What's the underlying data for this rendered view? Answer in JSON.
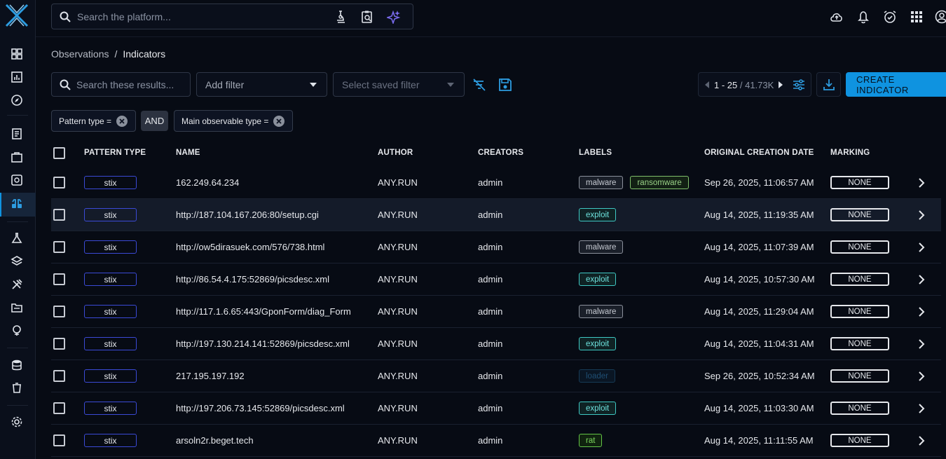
{
  "search": {
    "placeholder": "Search the platform..."
  },
  "breadcrumb": {
    "parent": "Observations",
    "separator": "/",
    "current": "Indicators"
  },
  "toolbar": {
    "search_placeholder": "Search these results...",
    "add_filter": "Add filter",
    "saved_filter": "Select saved filter",
    "pager_range": "1 - 25",
    "pager_total": " / 41.73K",
    "create_button": "CREATE INDICATOR"
  },
  "filters": {
    "chip1": "Pattern type =",
    "operator": "AND",
    "chip2": "Main observable type ="
  },
  "table": {
    "headers": {
      "pattern_type": "PATTERN TYPE",
      "name": "NAME",
      "author": "AUTHOR",
      "creators": "CREATORS",
      "labels": "LABELS",
      "date": "ORIGINAL CREATION DATE",
      "marking": "MARKING"
    },
    "rows": [
      {
        "pattern": "stix",
        "name": "162.249.64.234",
        "author": "ANY.RUN",
        "creator": "admin",
        "labels": [
          "malware",
          "ransomware"
        ],
        "date": "Sep 26, 2025, 11:06:57 AM",
        "marking": "NONE"
      },
      {
        "pattern": "stix",
        "name": "http://187.104.167.206:80/setup.cgi",
        "author": "ANY.RUN",
        "creator": "admin",
        "labels": [
          "exploit"
        ],
        "date": "Aug 14, 2025, 11:19:35 AM",
        "marking": "NONE"
      },
      {
        "pattern": "stix",
        "name": "http://ow5dirasuek.com/576/738.html",
        "author": "ANY.RUN",
        "creator": "admin",
        "labels": [
          "malware"
        ],
        "date": "Aug 14, 2025, 11:07:39 AM",
        "marking": "NONE"
      },
      {
        "pattern": "stix",
        "name": "http://86.54.4.175:52869/picsdesc.xml",
        "author": "ANY.RUN",
        "creator": "admin",
        "labels": [
          "exploit"
        ],
        "date": "Aug 14, 2025, 10:57:30 AM",
        "marking": "NONE"
      },
      {
        "pattern": "stix",
        "name": "http://117.1.6.65:443/GponForm/diag_Form",
        "author": "ANY.RUN",
        "creator": "admin",
        "labels": [
          "malware"
        ],
        "date": "Aug 14, 2025, 11:29:04 AM",
        "marking": "NONE"
      },
      {
        "pattern": "stix",
        "name": "http://197.130.214.141:52869/picsdesc.xml",
        "author": "ANY.RUN",
        "creator": "admin",
        "labels": [
          "exploit"
        ],
        "date": "Aug 14, 2025, 11:04:31 AM",
        "marking": "NONE"
      },
      {
        "pattern": "stix",
        "name": "217.195.197.192",
        "author": "ANY.RUN",
        "creator": "admin",
        "labels": [
          "loader"
        ],
        "date": "Sep 26, 2025, 10:52:34 AM",
        "marking": "NONE"
      },
      {
        "pattern": "stix",
        "name": "http://197.206.73.145:52869/picsdesc.xml",
        "author": "ANY.RUN",
        "creator": "admin",
        "labels": [
          "exploit"
        ],
        "date": "Aug 14, 2025, 11:03:30 AM",
        "marking": "NONE"
      },
      {
        "pattern": "stix",
        "name": "arsoln2r.beget.tech",
        "author": "ANY.RUN",
        "creator": "admin",
        "labels": [
          "rat"
        ],
        "date": "Aug 14, 2025, 11:11:55 AM",
        "marking": "NONE"
      }
    ]
  },
  "colors": {
    "accent": "#0f93e0",
    "background": "#070b14",
    "badge_border": "#3b4ad6"
  },
  "icons": [
    "search-icon",
    "microscope-icon",
    "clipboard-search-icon",
    "sparkle-icon",
    "cloud-upload-icon",
    "bell-icon",
    "alarm-check-icon",
    "apps-grid-icon",
    "account-icon",
    "filter-off-icon",
    "save-icon",
    "settings-sliders-icon",
    "download-icon"
  ]
}
